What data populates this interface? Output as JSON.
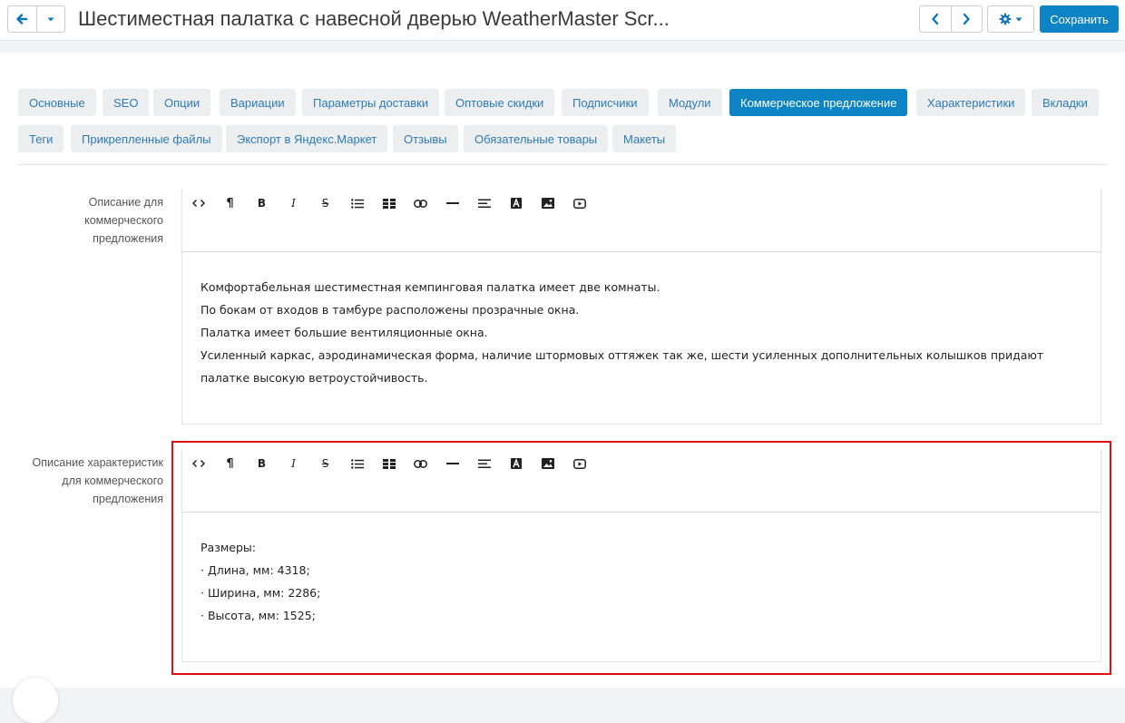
{
  "header": {
    "title": "Шестиместная палатка с навесной дверью WeatherMaster Scr...",
    "save_label": "Сохранить",
    "back_icon": "arrow-left-icon",
    "dropdown_icon": "caret-down-icon",
    "prev_icon": "chevron-left-icon",
    "next_icon": "chevron-right-icon",
    "settings_icon": "gear-icon"
  },
  "tabs": [
    {
      "label": "Основные"
    },
    {
      "label": "SEO"
    },
    {
      "label": "Опции"
    },
    {
      "label": "Вариации"
    },
    {
      "label": "Параметры доставки"
    },
    {
      "label": "Оптовые скидки"
    },
    {
      "label": "Подписчики"
    },
    {
      "label": "Модули"
    },
    {
      "label": "Коммерческое предложение",
      "active": true
    },
    {
      "label": "Характеристики"
    },
    {
      "label": "Вкладки"
    },
    {
      "label": "Теги"
    },
    {
      "label": "Прикрепленные файлы"
    },
    {
      "label": "Экспорт в Яндекс.Маркет"
    },
    {
      "label": "Отзывы"
    },
    {
      "label": "Обязательные товары"
    },
    {
      "label": "Макеты"
    }
  ],
  "editor_toolbar": [
    "code-view-icon",
    "paragraph-icon",
    "bold-icon",
    "italic-icon",
    "strikethrough-icon",
    "unordered-list-icon",
    "table-icon",
    "link-icon",
    "horizontal-rule-icon",
    "align-icon",
    "font-color-icon",
    "image-icon",
    "video-icon"
  ],
  "fields": [
    {
      "label": "Описание для коммерческого предложения",
      "lines": [
        "Комфортабельная шестиместная кемпинговая палатка имеет две комнаты.",
        "По бокам от входов в тамбуре расположены прозрачные окна.",
        "Палатка имеет большие вентиляционные окна.",
        "Усиленный каркас, аэродинамическая форма, наличие штормовых оттяжек так же, шести усиленных дополнительных колышков придают палатке высокую ветроустойчивость."
      ]
    },
    {
      "label": "Описание характеристик для коммерческого предложения",
      "lines": [
        "Размеры:",
        "· Длина, мм: 4318;",
        "· Ширина, мм: 2286;",
        "· Высота, мм: 1525;"
      ]
    }
  ],
  "colors": {
    "accent": "#0e84c5",
    "highlight": "#e01010"
  }
}
